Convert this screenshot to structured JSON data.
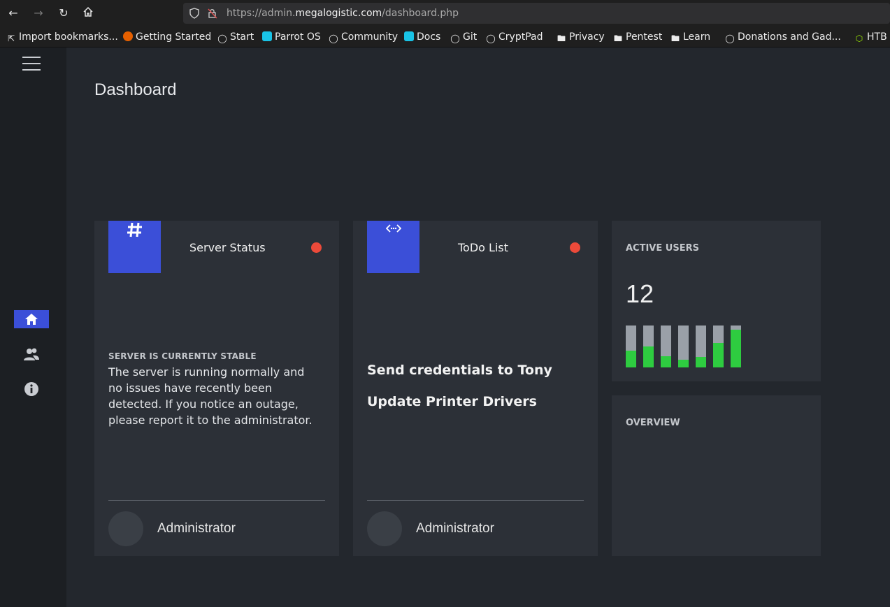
{
  "browser": {
    "url_prefix": "https://admin.",
    "url_host": "megalogistic.com",
    "url_path": "/dashboard.php",
    "bookmarks": [
      {
        "label": "Import bookmarks...",
        "icon": "import-icon"
      },
      {
        "label": "Getting Started",
        "icon": "firefox-icon"
      },
      {
        "label": "Start",
        "icon": "globe-icon"
      },
      {
        "label": "Parrot OS",
        "icon": "parrot-icon"
      },
      {
        "label": "Community",
        "icon": "globe-icon"
      },
      {
        "label": "Docs",
        "icon": "parrot-icon"
      },
      {
        "label": "Git",
        "icon": "globe-icon"
      },
      {
        "label": "CryptPad",
        "icon": "globe-icon"
      },
      {
        "label": "Privacy",
        "icon": "folder-icon"
      },
      {
        "label": "Pentest",
        "icon": "folder-icon"
      },
      {
        "label": "Learn",
        "icon": "folder-icon"
      },
      {
        "label": "Donations and Gad...",
        "icon": "globe-icon"
      },
      {
        "label": "HTB",
        "icon": "htb-icon"
      }
    ]
  },
  "page": {
    "title": "Dashboard"
  },
  "sidebar": {
    "items": [
      {
        "name": "home",
        "icon": "home-icon",
        "active": true
      },
      {
        "name": "users",
        "icon": "users-icon",
        "active": false
      },
      {
        "name": "info",
        "icon": "info-icon",
        "active": false
      }
    ]
  },
  "server_card": {
    "title": "Server Status",
    "icon": "hash-icon",
    "status_heading": "SERVER IS CURRENTLY STABLE",
    "status_text": "The server is running normally and no issues have recently been detected. If you notice an outage, please report it to the administrator.",
    "owner": "Administrator"
  },
  "todo_card": {
    "title": "ToDo List",
    "icon": "code-icon",
    "items": [
      "Send credentials to Tony",
      "Update Printer Drivers"
    ],
    "owner": "Administrator"
  },
  "active_users_card": {
    "title": "ACTIVE USERS",
    "count": "12",
    "bars": [
      0.4,
      0.5,
      0.27,
      0.18,
      0.25,
      0.58,
      0.9
    ]
  },
  "overview_card": {
    "title": "OVERVIEW"
  },
  "colors": {
    "accent": "#3b4fd8",
    "status_dot": "#ec4a3a",
    "bar_fill": "#2ecc40"
  }
}
